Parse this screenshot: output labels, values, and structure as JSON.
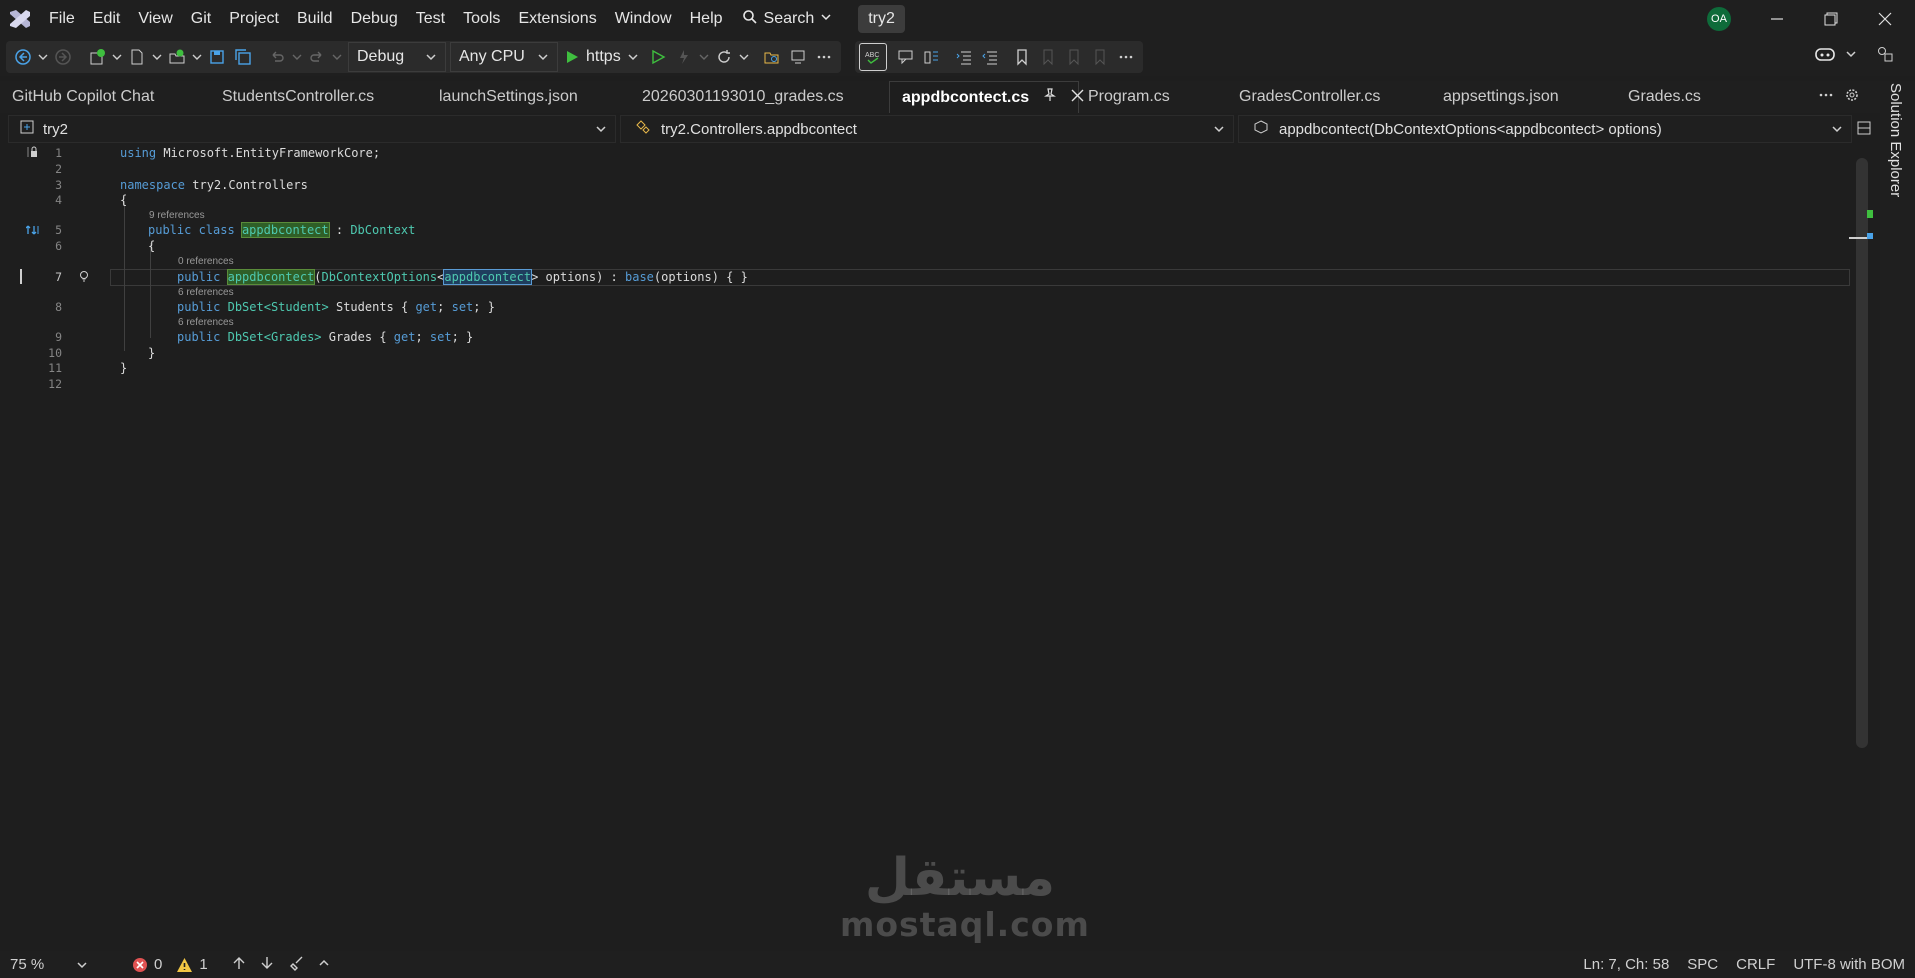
{
  "menu": {
    "items": [
      "File",
      "Edit",
      "View",
      "Git",
      "Project",
      "Build",
      "Debug",
      "Test",
      "Tools",
      "Extensions",
      "Window",
      "Help"
    ],
    "search_label": "Search",
    "solution_name": "try2",
    "user_initials": "OA"
  },
  "toolbar": {
    "configuration": "Debug",
    "platform": "Any CPU",
    "run_target": "https",
    "icons": [
      "back-icon",
      "forward-icon",
      "new-project-icon",
      "new-file-icon",
      "add-item-icon",
      "save-icon",
      "save-all-icon",
      "undo-icon",
      "redo-icon",
      "run-icon",
      "start-without-debug-icon",
      "hot-reload-icon",
      "refresh-icon",
      "find-in-files-icon",
      "screen-icon",
      "more-icon",
      "spell-check-icon",
      "comment-icon",
      "format-icon",
      "indent-icon",
      "outdent-icon",
      "bookmark-icon",
      "copilot-icon",
      "feedback-icon"
    ]
  },
  "tabs": [
    "GitHub Copilot Chat",
    "StudentsController.cs",
    "launchSettings.json",
    "20260301193010_grades.cs",
    "appdbcontect.cs",
    "Program.cs",
    "GradesController.cs",
    "appsettings.json",
    "Grades.cs"
  ],
  "active_tab": "appdbcontect.cs",
  "navbar": {
    "project": "try2",
    "class": "try2.Controllers.appdbcontect",
    "member": "appdbcontect(DbContextOptions<appdbcontect> options)"
  },
  "code": {
    "line_numbers": [
      "1",
      "2",
      "3",
      "4",
      "5",
      "6",
      "7",
      "8",
      "9",
      "10",
      "11",
      "12"
    ],
    "current_line": "7",
    "lines": {
      "l1": {
        "kw": "using",
        "rest": " Microsoft.EntityFrameworkCore;"
      },
      "l3": {
        "kw": "namespace",
        "rest": " try2.Controllers"
      },
      "l4": "{",
      "l5": {
        "kw": "public class",
        "name": "appdbcontect",
        "sep": " : ",
        "base": "DbContext"
      },
      "l6": "{",
      "l7": {
        "kw": "public",
        "name": "appdbcontect",
        "open": "(",
        "type": "DbContextOptions",
        "lt": "<",
        "arg": "appdbcontect",
        "gt": ">",
        "rest": " options) : ",
        "kw2": "base",
        "tail": "(options) { }"
      },
      "l8": {
        "kw": "public",
        "type": "DbSet",
        "generic": "<Student>",
        "rest": " Students { ",
        "get": "get",
        "semi1": "; ",
        "set": "set",
        "tail": "; }"
      },
      "l9": {
        "kw": "public",
        "type": "DbSet",
        "generic": "<Grades>",
        "rest": " Grades { ",
        "get": "get",
        "semi1": "; ",
        "set": "set",
        "tail": "; }"
      },
      "l10": "}",
      "l11": "}"
    },
    "lens": {
      "class_refs": "9 references",
      "ctor_refs": "0 references",
      "students_refs": "6 references",
      "grades_refs": "6 references"
    }
  },
  "status": {
    "zoom": "75 %",
    "errors": "0",
    "warnings": "1",
    "position": "Ln: 7, Ch: 58",
    "indent": "SPC",
    "line_ending": "CRLF",
    "encoding": "UTF-8 with BOM"
  },
  "side_panel": {
    "solution_explorer": "Solution Explorer"
  },
  "watermark": {
    "arabic": "مستقل",
    "latin": "mostaql.com"
  },
  "colors": {
    "keyword": "#569cd6",
    "type": "#4ec9b0",
    "highlight": "#2f5f27",
    "error": "#e05252",
    "warning": "#f2c744",
    "run": "#3fbf3f"
  }
}
